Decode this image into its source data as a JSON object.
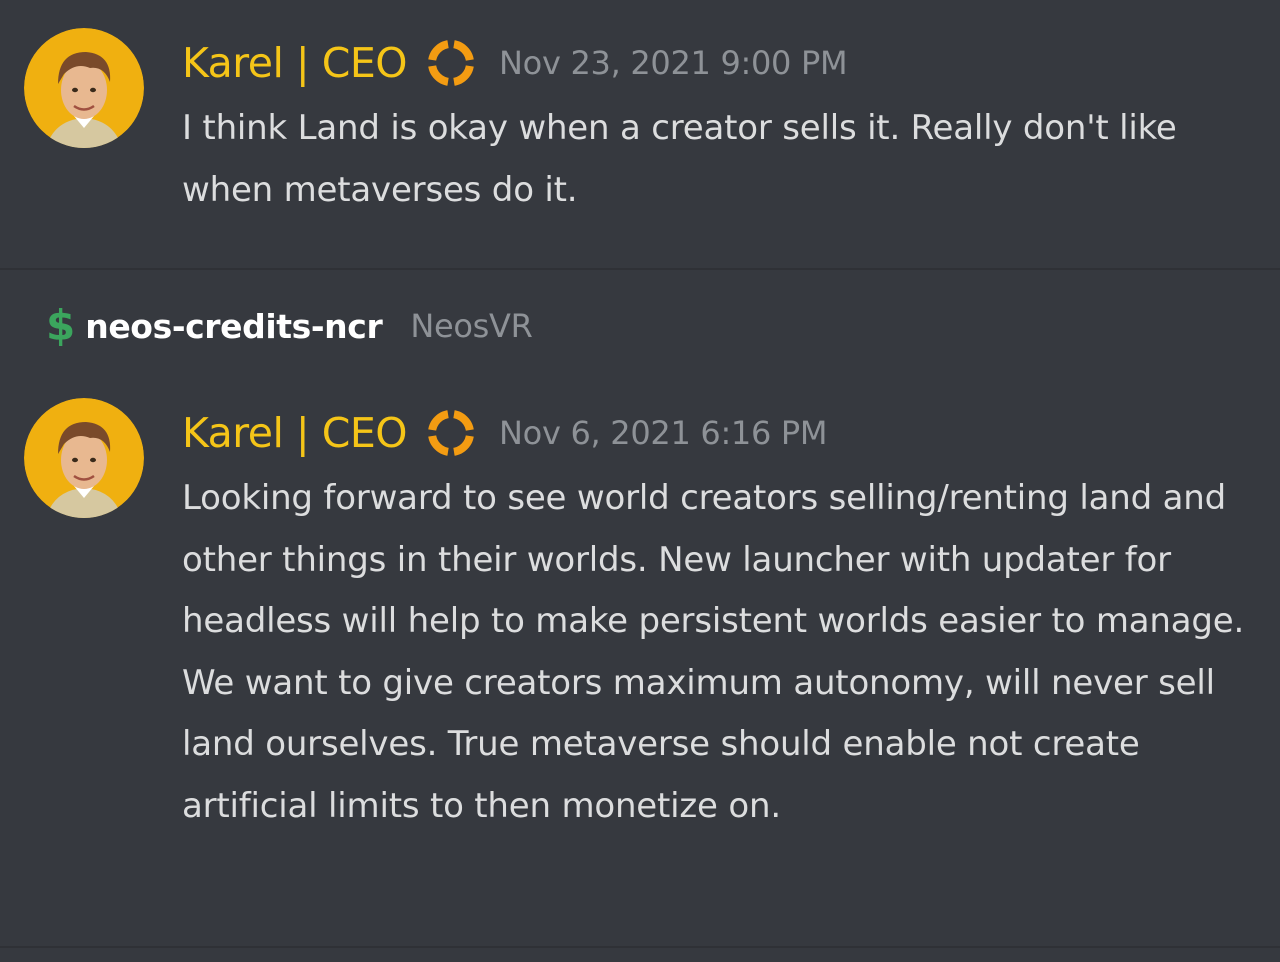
{
  "messages": [
    {
      "author": "Karel | CEO",
      "timestamp": "Nov 23, 2021 9:00 PM",
      "text": "I think Land is okay when a creator sells it. Really don't like when metaverses do it."
    },
    {
      "author": "Karel | CEO",
      "timestamp": "Nov 6, 2021 6:16 PM",
      "text": "Looking forward to see world creators selling/renting land and other things in their worlds. New launcher with updater for headless will help to make persistent worlds easier to manage.\nWe want to give creators maximum autonomy, will never sell land ourselves. True metaverse should enable not create artificial limits to then monetize on."
    }
  ],
  "channel": {
    "icon": "dollar-icon",
    "icon_glyph": "$",
    "name": "neos-credits-ncr",
    "server": "NeosVR"
  },
  "colors": {
    "background": "#36393f",
    "username": "#f5c518",
    "timestamp": "#8e9297",
    "message_text": "#dcddde",
    "channel_icon": "#3ba55d",
    "badge": "#f39c12"
  }
}
